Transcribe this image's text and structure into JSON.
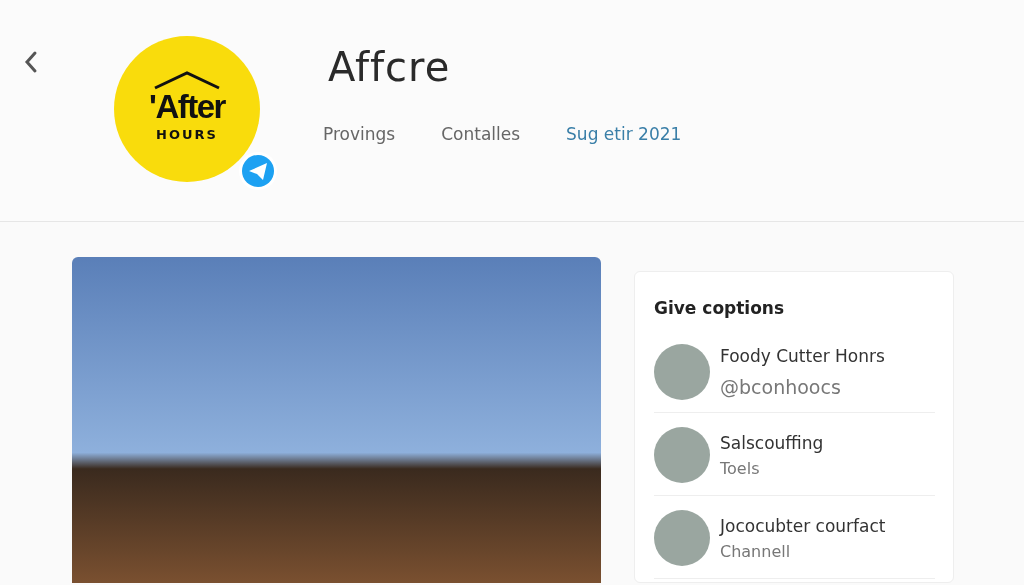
{
  "header": {
    "logo": {
      "line_1": "'After",
      "line_2": "HOURS"
    },
    "title": "Affcre",
    "tabs": [
      {
        "label": "Provings",
        "selected": false
      },
      {
        "label": "Contalles",
        "selected": false
      },
      {
        "label": "Sug etir 2021",
        "selected": true
      }
    ]
  },
  "suggestions": {
    "title": "Give coptions",
    "items": [
      {
        "name": "Foody Cutter Honrs",
        "subtitle": "@bconhoocs"
      },
      {
        "name": "Salscouffing",
        "subtitle": "Toels"
      },
      {
        "name": "Jococubter courfact",
        "subtitle": "Channell"
      }
    ]
  }
}
